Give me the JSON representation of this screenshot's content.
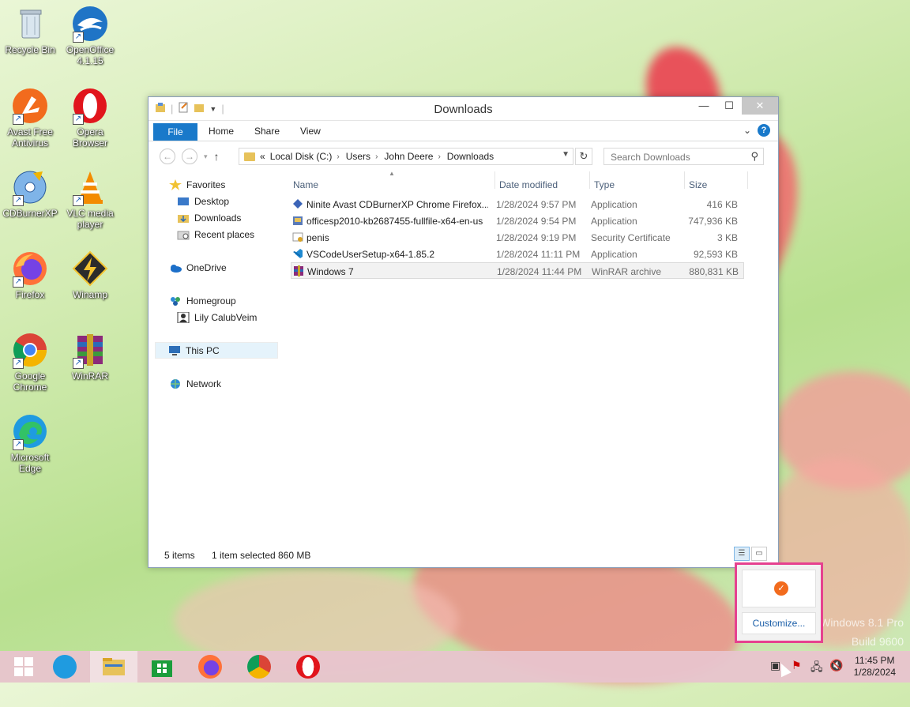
{
  "desktop": {
    "watermark_line1": "Windows 8.1 Pro",
    "watermark_line2": "Build 9600",
    "icons": [
      {
        "label": "Recycle Bin",
        "icon": "recycle-bin-icon"
      },
      {
        "label": "OpenOffice 4.1.15",
        "icon": "openoffice-icon"
      },
      {
        "label": "Avast Free Antivirus",
        "icon": "avast-icon"
      },
      {
        "label": "Opera Browser",
        "icon": "opera-icon"
      },
      {
        "label": "CDBurnerXP",
        "icon": "cdburnerxp-icon"
      },
      {
        "label": "VLC media player",
        "icon": "vlc-icon"
      },
      {
        "label": "Firefox",
        "icon": "firefox-icon"
      },
      {
        "label": "Winamp",
        "icon": "winamp-icon"
      },
      {
        "label": "Google Chrome",
        "icon": "chrome-icon"
      },
      {
        "label": "WinRAR",
        "icon": "winrar-icon"
      },
      {
        "label": "Microsoft Edge",
        "icon": "edge-icon"
      }
    ]
  },
  "window": {
    "title": "Downloads",
    "ribbon_tabs": {
      "file": "File",
      "home": "Home",
      "share": "Share",
      "view": "View"
    },
    "help_label": "?",
    "address": {
      "prefix": "«",
      "crumbs": [
        "Local Disk (C:)",
        "Users",
        "John Deere",
        "Downloads"
      ]
    },
    "search_placeholder": "Search Downloads",
    "nav": {
      "favorites": "Favorites",
      "desktop": "Desktop",
      "downloads": "Downloads",
      "recent": "Recent places",
      "onedrive": "OneDrive",
      "homegroup": "Homegroup",
      "homegroup_user": "Lily CalubVeim",
      "thispc": "This PC",
      "network": "Network"
    },
    "columns": {
      "name": "Name",
      "date": "Date modified",
      "type": "Type",
      "size": "Size"
    },
    "files": [
      {
        "name": "Ninite Avast CDBurnerXP Chrome Firefox...",
        "date": "1/28/2024 9:57 PM",
        "type": "Application",
        "size": "416 KB",
        "icon": "ninite-icon"
      },
      {
        "name": "officesp2010-kb2687455-fullfile-x64-en-us",
        "date": "1/28/2024 9:54 PM",
        "type": "Application",
        "size": "747,936 KB",
        "icon": "installer-icon"
      },
      {
        "name": "penis",
        "date": "1/28/2024 9:19 PM",
        "type": "Security Certificate",
        "size": "3 KB",
        "icon": "certificate-icon"
      },
      {
        "name": "VSCodeUserSetup-x64-1.85.2",
        "date": "1/28/2024 11:11 PM",
        "type": "Application",
        "size": "92,593 KB",
        "icon": "vscode-icon"
      },
      {
        "name": "Windows 7",
        "date": "1/28/2024 11:44 PM",
        "type": "WinRAR archive",
        "size": "880,831 KB",
        "icon": "winrar-archive-icon"
      }
    ],
    "selected_index": 4,
    "status": {
      "items": "5 items",
      "selected": "1 item selected",
      "size": "860 MB"
    }
  },
  "tray_popup": {
    "customize": "Customize..."
  },
  "taskbar": {
    "time": "11:45 PM",
    "date": "1/28/2024",
    "pinned": [
      "start-button",
      "edge-taskbar",
      "file-explorer-taskbar",
      "store-taskbar",
      "firefox-taskbar",
      "chrome-taskbar",
      "opera-taskbar"
    ]
  }
}
